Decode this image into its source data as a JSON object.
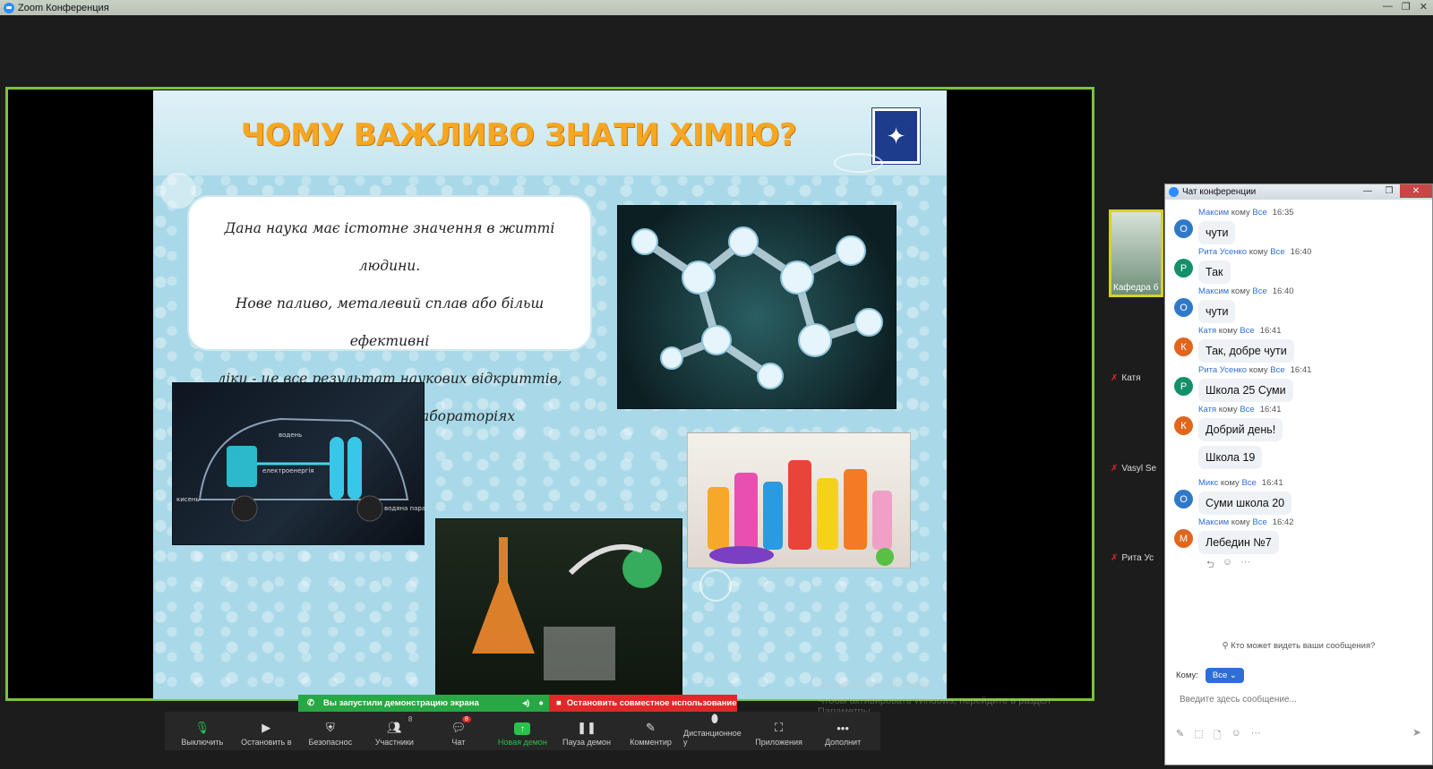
{
  "window": {
    "title": "Zoom Конференция",
    "controls": [
      "—",
      "❐",
      "✕"
    ]
  },
  "slide": {
    "title": "ЧОМУ ВАЖЛИВО ЗНАТИ ХІМІЮ?",
    "text_lines": [
      "Дана наука має істотне значення в житті людини.",
      "Нове паливо, металевий сплав або більш ефективні",
      "ліки - це все результат наукових відкриттів,",
      "що здійснюється в лабораторіях"
    ],
    "car_labels": [
      "водень",
      "електроенергія",
      "кисень",
      "водяна пара"
    ]
  },
  "share_bar": {
    "notice": "Вы запустили демонстрацию экрана",
    "stop": "Остановить совместное использование"
  },
  "toolbar": {
    "items": [
      {
        "label": "Выключить",
        "icon": "microphone-icon"
      },
      {
        "label": "Остановить в",
        "icon": "video-camera-icon"
      },
      {
        "label": "Безопаснос",
        "icon": "shield-icon"
      },
      {
        "label": "Участники",
        "icon": "participants-icon",
        "count": "8"
      },
      {
        "label": "Чат",
        "icon": "chat-icon",
        "badge": "8"
      },
      {
        "label": "Новая демон",
        "icon": "share-screen-icon"
      },
      {
        "label": "Пауза демон",
        "icon": "pause-icon"
      },
      {
        "label": "Комментир",
        "icon": "pencil-icon"
      },
      {
        "label": "Дистанционное у",
        "icon": "mouse-icon"
      },
      {
        "label": "Приложения",
        "icon": "apps-icon"
      },
      {
        "label": "Дополнит",
        "icon": "more-icon"
      }
    ]
  },
  "watermark": {
    "line1": "Активация Windows",
    "line2": "Чтобы активировать Windows, перейдите в раздел",
    "line3": "Параметры"
  },
  "participants": [
    {
      "name": "Кафедра б"
    },
    {
      "name": "Катя"
    },
    {
      "name": "Vasyl Se"
    },
    {
      "name": "Рита Ус"
    }
  ],
  "chat": {
    "title": "Чат конференции",
    "messages": [
      {
        "name": "Максим",
        "to_word": "кому",
        "to": "Все",
        "time": "16:35",
        "text": "чути",
        "initial": "О",
        "color": "#2f79c8"
      },
      {
        "name": "Рита Усенко",
        "to_word": "кому",
        "to": "Все",
        "time": "16:40",
        "text": "Так",
        "initial": "Р",
        "color": "#12906a"
      },
      {
        "name": "Максим",
        "to_word": "кому",
        "to": "Все",
        "time": "16:40",
        "text": "чути",
        "initial": "О",
        "color": "#2f79c8"
      },
      {
        "name": "Катя",
        "to_word": "кому",
        "to": "Все",
        "time": "16:41",
        "text": "Так, добре чути",
        "initial": "К",
        "color": "#e0661e"
      },
      {
        "name": "Рита Усенко",
        "to_word": "кому",
        "to": "Все",
        "time": "16:41",
        "text": "Школа 25 Суми",
        "initial": "Р",
        "color": "#12906a"
      },
      {
        "name": "Катя",
        "to_word": "кому",
        "to": "Все",
        "time": "16:41",
        "text": "Добрий день!",
        "initial": "К",
        "color": "#e0661e"
      },
      {
        "name": "Микс",
        "to_word": "кому",
        "to": "Все",
        "time": "16:41",
        "text": "Суми школа 20",
        "initial": "О",
        "color": "#2f79c8"
      },
      {
        "name": "Максим",
        "to_word": "кому",
        "to": "Все",
        "time": "16:42",
        "text": "Лебедин №7",
        "initial": "М",
        "color": "#e0661e"
      }
    ],
    "extra_message": "Школа 19",
    "who_can_see": "Кто может видеть ваши сообщения?",
    "to_label": "Кому:",
    "to_value": "Все",
    "input_placeholder": "Введите здесь сообщение..."
  }
}
